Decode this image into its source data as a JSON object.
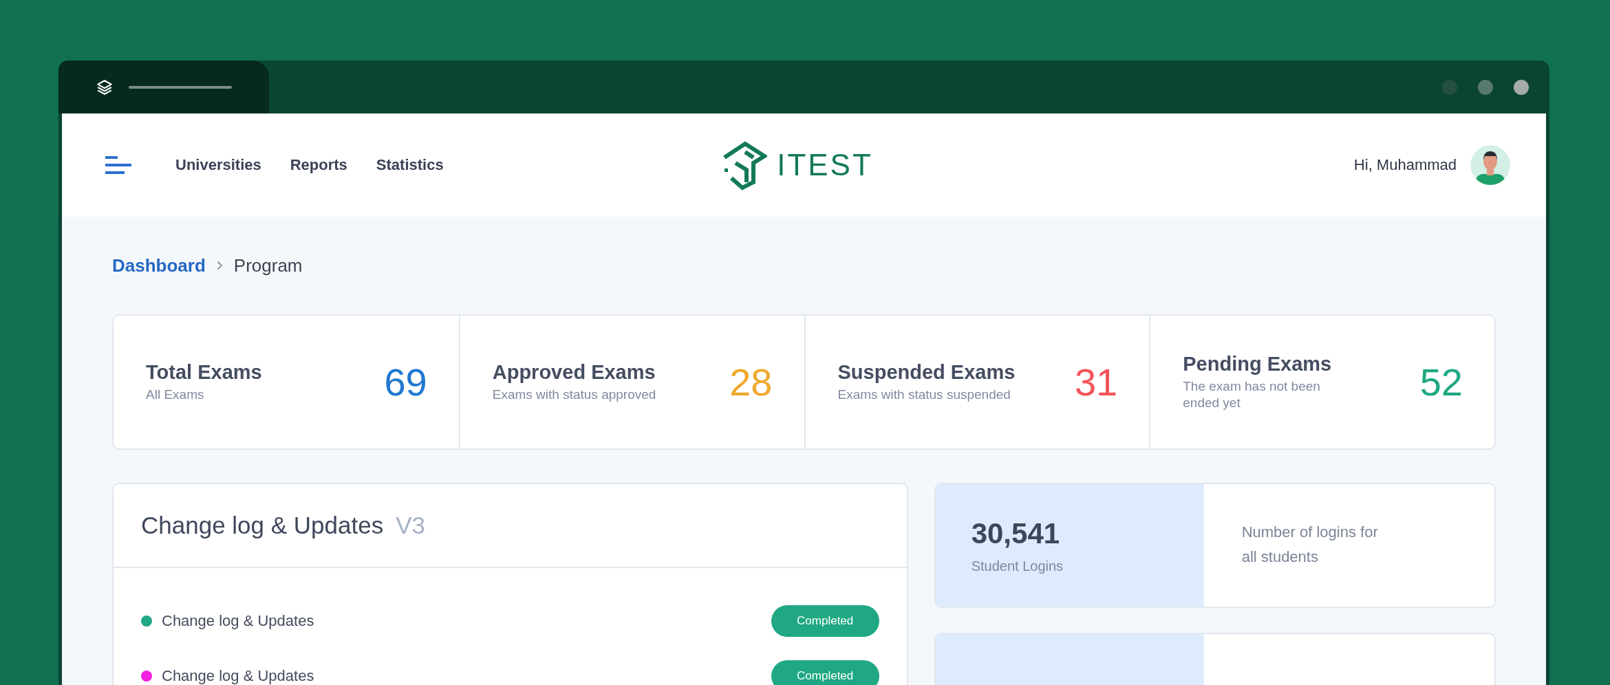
{
  "nav": {
    "links": [
      {
        "label": "Universities"
      },
      {
        "label": "Reports"
      },
      {
        "label": "Statistics"
      }
    ]
  },
  "brand": {
    "name": "ITEST"
  },
  "user": {
    "greeting": "Hi, Muhammad"
  },
  "breadcrumb": [
    {
      "label": "Dashboard",
      "kind": "link"
    },
    {
      "label": "Program",
      "kind": "current"
    }
  ],
  "stats": [
    {
      "title": "Total Exams",
      "subtitle": "All Exams",
      "value": "69",
      "color": "#1f78d1"
    },
    {
      "title": "Approved Exams",
      "subtitle": "Exams with status approved",
      "value": "28",
      "color": "#f0a92d"
    },
    {
      "title": "Suspended Exams",
      "subtitle": "Exams with status suspended",
      "value": "31",
      "color": "#f2545b"
    },
    {
      "title": "Pending Exams",
      "subtitle": "The exam has not been ended yet",
      "value": "52",
      "color": "#1fa883"
    }
  ],
  "changelog": {
    "title": "Change log & Updates",
    "version": "V3",
    "items": [
      {
        "label": "Change log & Updates",
        "color": "#1fa883",
        "status": "Completed"
      },
      {
        "label": "Change log & Updates",
        "color": "#f21fe0",
        "status": "Completed"
      }
    ]
  },
  "login_cards": [
    {
      "kind": "full",
      "value": "30,541",
      "label": "Student Logins",
      "description": "Number of logins for all students"
    },
    {
      "kind": "partial"
    }
  ]
}
